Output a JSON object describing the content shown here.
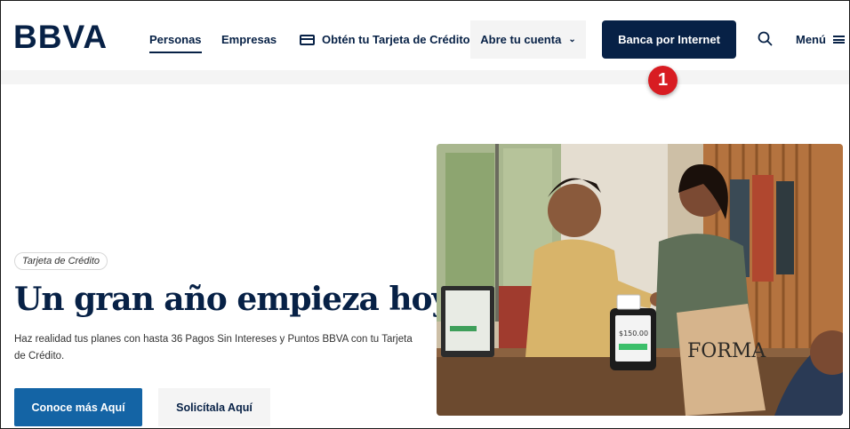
{
  "header": {
    "logo": "BBVA",
    "nav": {
      "personas": "Personas",
      "empresas": "Empresas",
      "tarjeta": "Obtén tu Tarjeta de Crédito"
    },
    "abre_cuenta": "Abre tu cuenta",
    "banca_internet": "Banca por Internet",
    "menu": "Menú"
  },
  "marker": {
    "label": "1"
  },
  "hero": {
    "tag": "Tarjeta de Crédito",
    "headline": "Un gran año empieza hoy",
    "description": "Haz realidad tus planes con hasta 36 Pagos Sin Intereses y Puntos BBVA con tu Tarjeta de Crédito.",
    "cta_primary": "Conoce más Aquí",
    "cta_secondary": "Solicítala Aquí",
    "image": {
      "pos_screen": "$150.00",
      "bag_text": "FORMA"
    }
  },
  "colors": {
    "navy": "#072146",
    "primary_blue": "#1464a5",
    "marker_red": "#d81c22",
    "light_gray": "#f4f4f4"
  },
  "icons": [
    "card-icon",
    "chevron-down-icon",
    "search-icon",
    "menu-icon"
  ]
}
